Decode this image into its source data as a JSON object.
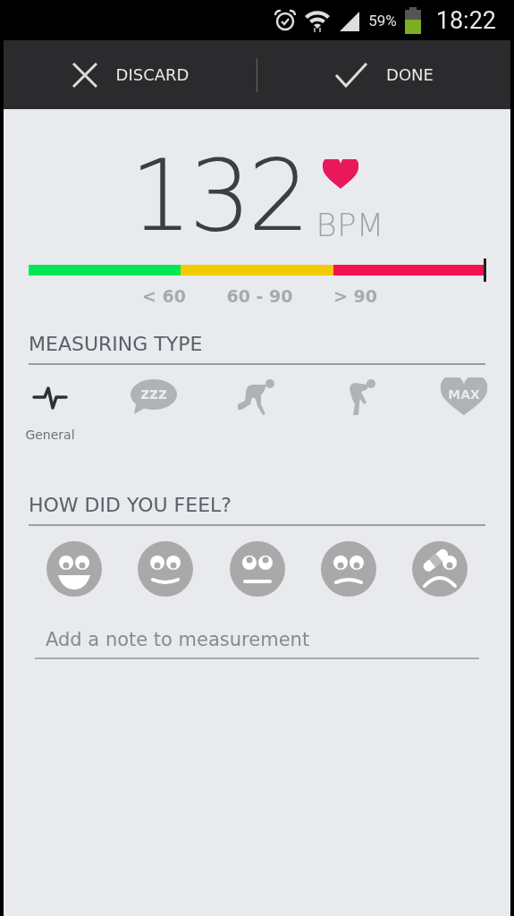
{
  "status_bar": {
    "battery": "59%",
    "time": "18:22"
  },
  "action_bar": {
    "buttons": [
      {
        "kind": "discard",
        "label": "DISCARD"
      },
      {
        "kind": "done",
        "label": "DONE"
      }
    ]
  },
  "reading": {
    "value": "132",
    "unit": "BPM"
  },
  "scale": {
    "segments": [
      {
        "label": "< 60",
        "color": "#00e655"
      },
      {
        "label": "60 - 90",
        "color": "#f0cc00"
      },
      {
        "label": "> 90",
        "color": "#f5114f"
      }
    ],
    "level": 1
  },
  "measuring_type": {
    "title": "MEASURING TYPE",
    "types": [
      {
        "kind": "general",
        "label": "General",
        "selected": true
      },
      {
        "kind": "sleep",
        "icon_text": "zzz",
        "selected": false
      },
      {
        "kind": "start",
        "selected": false
      },
      {
        "kind": "tired",
        "selected": false
      },
      {
        "kind": "max",
        "icon_text": "MAX",
        "selected": false
      }
    ]
  },
  "feeling": {
    "title": "HOW DID YOU FEEL?",
    "moods": [
      {
        "kind": "great"
      },
      {
        "kind": "good"
      },
      {
        "kind": "neutral"
      },
      {
        "kind": "sad"
      },
      {
        "kind": "hurt"
      }
    ]
  },
  "note": {
    "placeholder": "Add a note to measurement"
  }
}
